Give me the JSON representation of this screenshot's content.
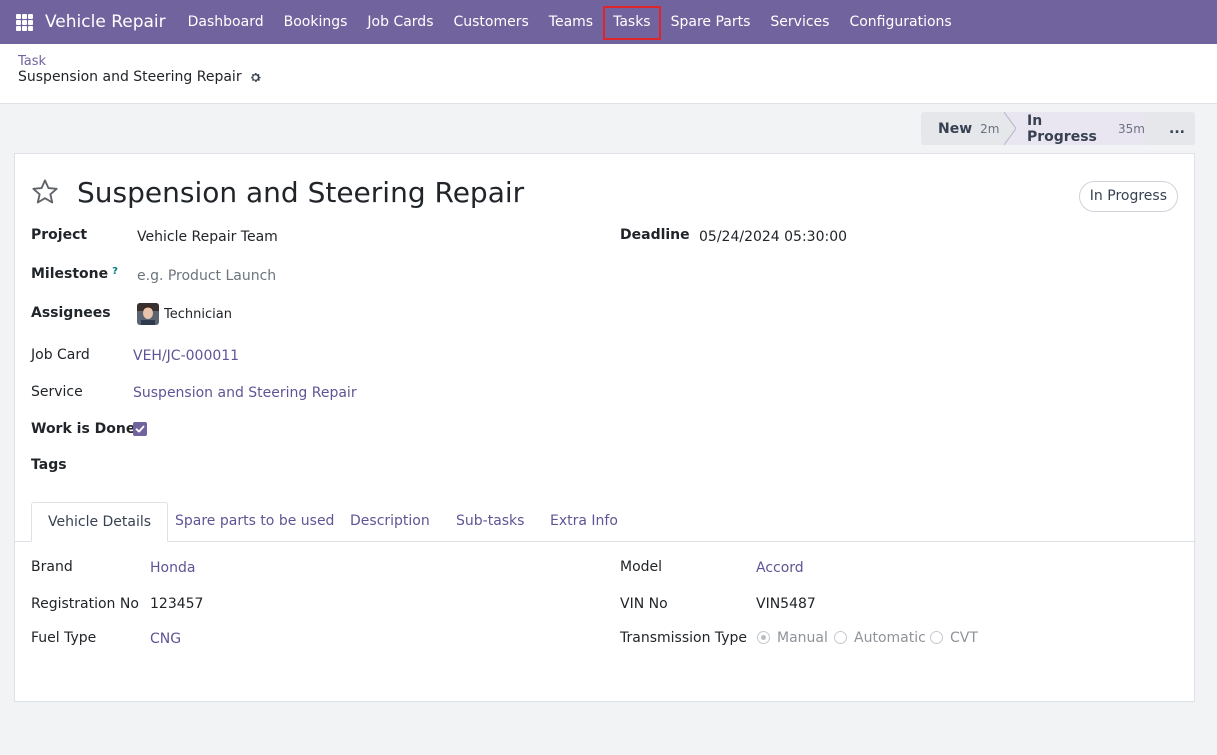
{
  "navbar": {
    "brand": "Vehicle Repair",
    "items": [
      "Dashboard",
      "Bookings",
      "Job Cards",
      "Customers",
      "Teams",
      "Tasks",
      "Spare Parts",
      "Services",
      "Configurations"
    ],
    "bg_color": "#71639e",
    "highlighted": "Tasks",
    "highlight_color": "#e0242c"
  },
  "breadcrumb": {
    "parent": "Task",
    "current": "Suspension and Steering Repair"
  },
  "statusbar": {
    "stages": [
      {
        "name": "New",
        "duration": "2m"
      },
      {
        "name": "In Progress",
        "duration": "35m"
      }
    ],
    "more": "...",
    "active": "In Progress"
  },
  "form": {
    "title": "Suspension and Steering Repair",
    "state": "In Progress",
    "project_label": "Project",
    "project_value": "Vehicle Repair Team",
    "milestone_label": "Milestone",
    "milestone_help": "?",
    "milestone_placeholder": "e.g. Product Launch",
    "assignees_label": "Assignees",
    "assignee_name": "Technician",
    "deadline_label": "Deadline",
    "deadline_value": "05/24/2024 05:30:00",
    "job_card_label": "Job Card",
    "job_card_value": "VEH/JC-000011",
    "service_label": "Service",
    "service_value": "Suspension and Steering Repair",
    "work_done_label": "Work is Done",
    "work_done_checked": true,
    "tags_label": "Tags"
  },
  "tabs": [
    "Vehicle Details",
    "Spare parts to be used",
    "Description",
    "Sub-tasks",
    "Extra Info"
  ],
  "vehicle": {
    "brand_label": "Brand",
    "brand_value": "Honda",
    "registration_label": "Registration No",
    "registration_value": "123457",
    "fuel_label": "Fuel Type",
    "fuel_value": "CNG",
    "model_label": "Model",
    "model_value": "Accord",
    "vin_label": "VIN No",
    "vin_value": "VIN5487",
    "transmission_label": "Transmission Type",
    "transmission_options": [
      "Manual",
      "Automatic",
      "CVT"
    ],
    "transmission_selected": "Manual"
  }
}
